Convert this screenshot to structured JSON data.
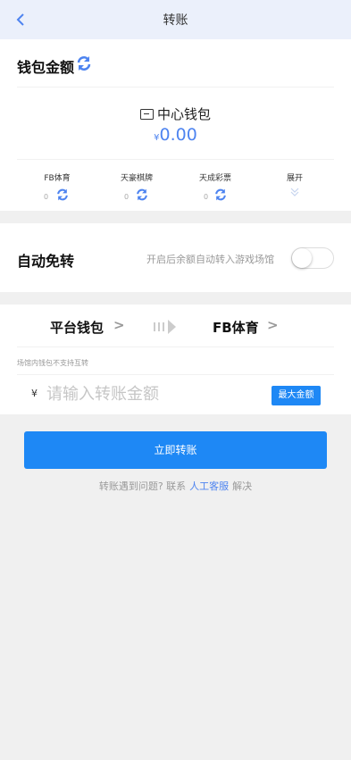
{
  "header": {
    "title": "转账"
  },
  "wallet": {
    "heading": "钱包金额",
    "center_name": "中心钱包",
    "currency": "¥",
    "center_amount": "0.00",
    "subs": [
      {
        "label": "FB体育",
        "value": "0"
      },
      {
        "label": "天豪棋牌",
        "value": "0"
      },
      {
        "label": "天成彩票",
        "value": "0"
      }
    ],
    "expand_label": "展开"
  },
  "auto": {
    "title": "自动免转",
    "description": "开启后余额自动转入游戏场馆",
    "enabled": false
  },
  "transfer": {
    "from": "平台钱包",
    "to": "FB体育",
    "chevron": ">",
    "note": "场馆内钱包不支持互转",
    "currency": "¥",
    "amount_placeholder": "请输入转账金额",
    "max_label": "最大金额"
  },
  "submit_label": "立即转账",
  "help": {
    "prefix": "转账遇到问题? 联系",
    "link": "人工客服",
    "suffix": "解决"
  },
  "colors": {
    "accent": "#1e88f5",
    "amount": "#4e84f0",
    "header_bg": "#ebf0fb"
  }
}
